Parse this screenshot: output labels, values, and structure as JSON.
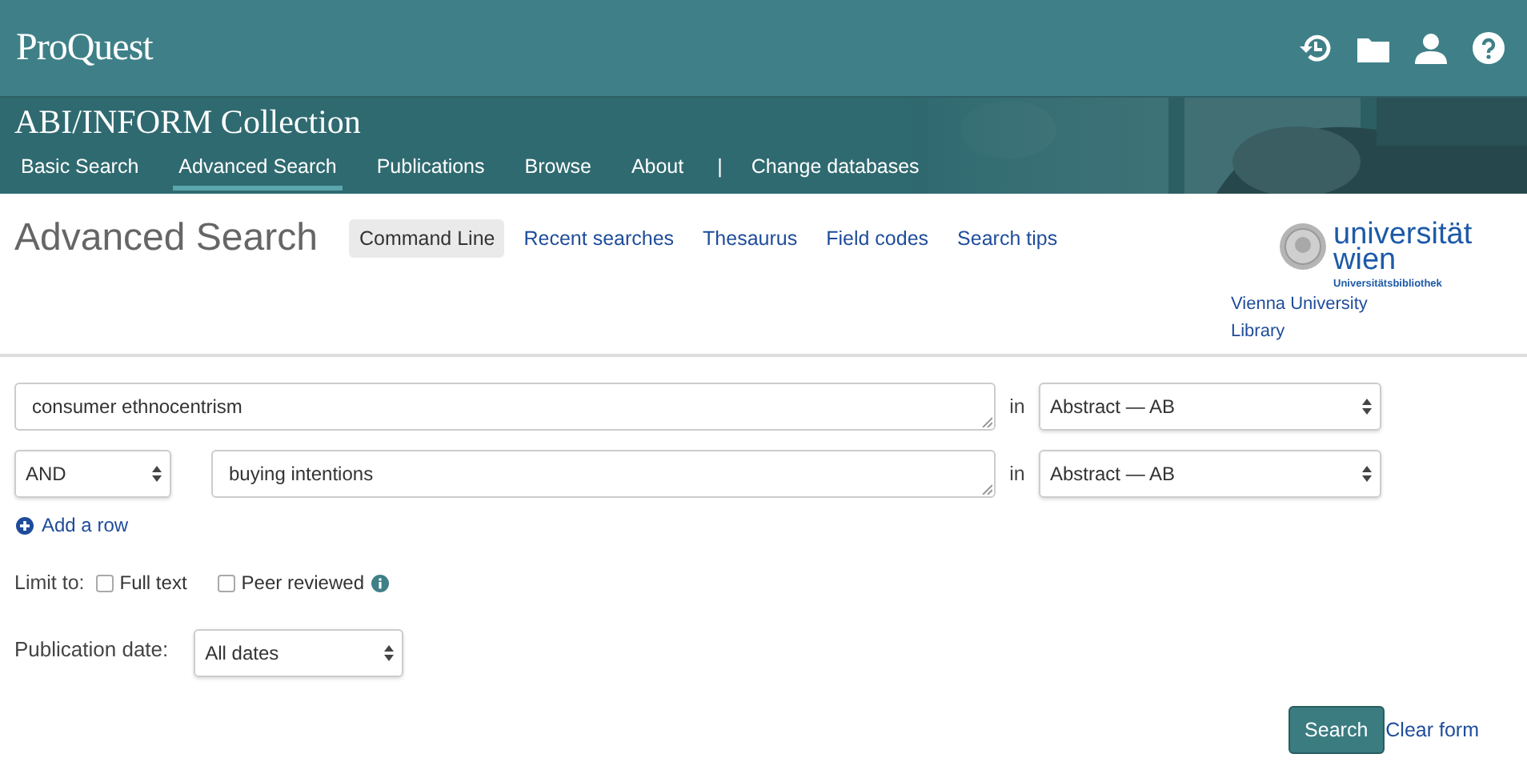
{
  "header": {
    "brand": "ProQuest"
  },
  "banner": {
    "title": "ABI/INFORM Collection",
    "kind": "picture",
    "nav": [
      {
        "label": "Basic Search",
        "selected": false
      },
      {
        "label": "Advanced Search",
        "selected": true
      },
      {
        "label": "Publications",
        "selected": false
      },
      {
        "label": "Browse",
        "selected": false
      },
      {
        "label": "About",
        "selected": false
      },
      {
        "label": "|",
        "kind": "separator"
      },
      {
        "label": "Change databases",
        "selected": false
      }
    ]
  },
  "page": {
    "title": "Advanced Search",
    "links": [
      {
        "label": "Command Line",
        "selected": true
      },
      {
        "label": "Recent searches",
        "selected": false
      },
      {
        "label": "Thesaurus",
        "selected": false
      },
      {
        "label": "Field codes",
        "selected": false
      },
      {
        "label": "Search tips",
        "selected": false
      }
    ],
    "logo": {
      "name_line1": "universität",
      "name_line2": "wien",
      "subtitle": "Universitätsbibliothek",
      "caption": "Vienna University Library"
    }
  },
  "search_rows": [
    {
      "term": "consumer ethnocentrism",
      "in_label": "in",
      "field": "Abstract — AB"
    },
    {
      "operator": "AND",
      "term": "buying intentions",
      "in_label": "in",
      "field": "Abstract — AB"
    }
  ],
  "add_row": "Add a row",
  "limit": {
    "label": "Limit to:",
    "options": [
      {
        "label": "Full text",
        "checked": false,
        "info": false
      },
      {
        "label": "Peer reviewed",
        "checked": false,
        "info": true
      }
    ]
  },
  "publication_date": {
    "label": "Publication date:",
    "value": "All dates"
  },
  "buttons": {
    "search": "Search",
    "clear": "Clear form"
  }
}
